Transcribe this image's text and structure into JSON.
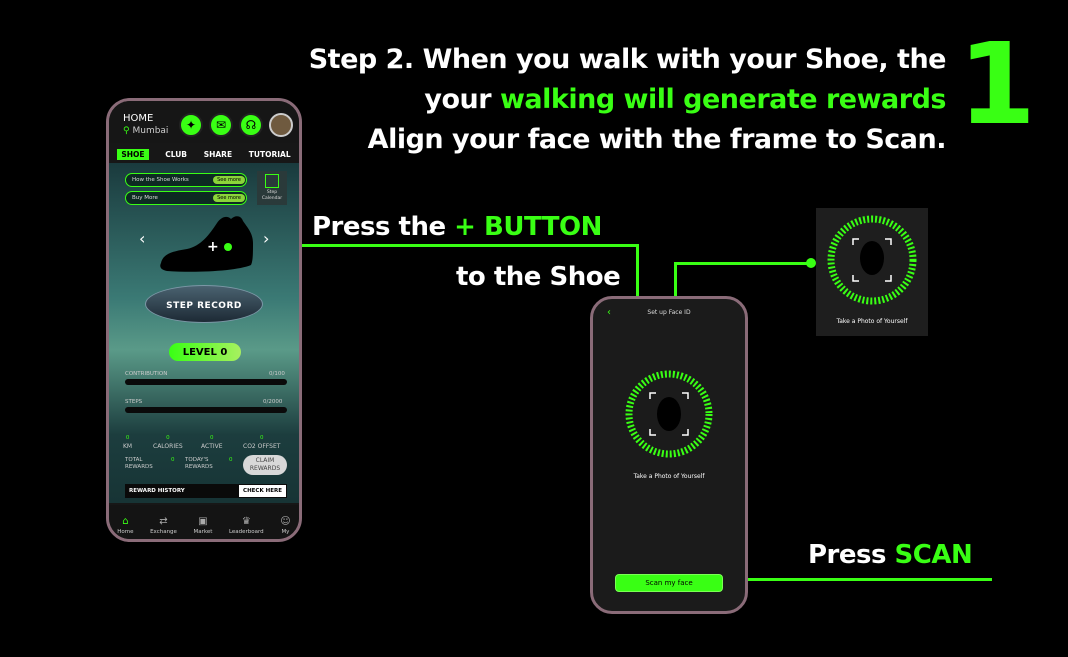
{
  "headline": {
    "line1": "Step 2. When you walk with your Shoe, the",
    "line2_pre": "your ",
    "line2_green": "walking will generate rewards",
    "line3": "Align your face with the frame to Scan.",
    "step_number": "1"
  },
  "callouts": {
    "plus_pre": "Press the",
    "plus_symbol": "+",
    "plus_button": "BUTTON",
    "plus_sub": "to the Shoe",
    "scan_pre": "Press",
    "scan_green": "SCAN"
  },
  "home_app": {
    "title": "HOME",
    "city": "Mumbai",
    "tabs": [
      "SHOE",
      "CLUB",
      "SHARE",
      "TUTORIAL"
    ],
    "pill_how": "How the Shoe Works",
    "pill_buy": "Buy More",
    "see_more": "See more",
    "calendar": "Step Calendar",
    "pedestal": "STEP RECORD",
    "level": "LEVEL 0",
    "contribution_label": "CONTRIBUTION",
    "contribution_value": "0/100",
    "steps_label": "STEPS",
    "steps_value": "0/2000",
    "stats": [
      {
        "value": "0",
        "label": "KM"
      },
      {
        "value": "0",
        "label": "CALORIES"
      },
      {
        "value": "0",
        "label": "ACTIVE"
      },
      {
        "value": "0",
        "label": "CO2 OFFSET"
      }
    ],
    "total_rewards": "TOTAL REWARDS",
    "todays_rewards": "TODAY'S REWARDS",
    "total_value": "0",
    "todays_value": "0",
    "claim": "CLAIM REWARDS",
    "reward_history": "REWARD HISTORY",
    "check_here": "CHECK HERE",
    "nav": [
      "Home",
      "Exchange",
      "Market",
      "Leaderboard",
      "My"
    ]
  },
  "faceid_app": {
    "title": "Set up Face ID",
    "prompt": "Take a Photo of Yourself",
    "scan_button": "Scan my face"
  },
  "face_card": {
    "prompt": "Take a Photo of Yourself"
  },
  "colors": {
    "accent": "#39ff14",
    "frame": "#8a6b78"
  }
}
